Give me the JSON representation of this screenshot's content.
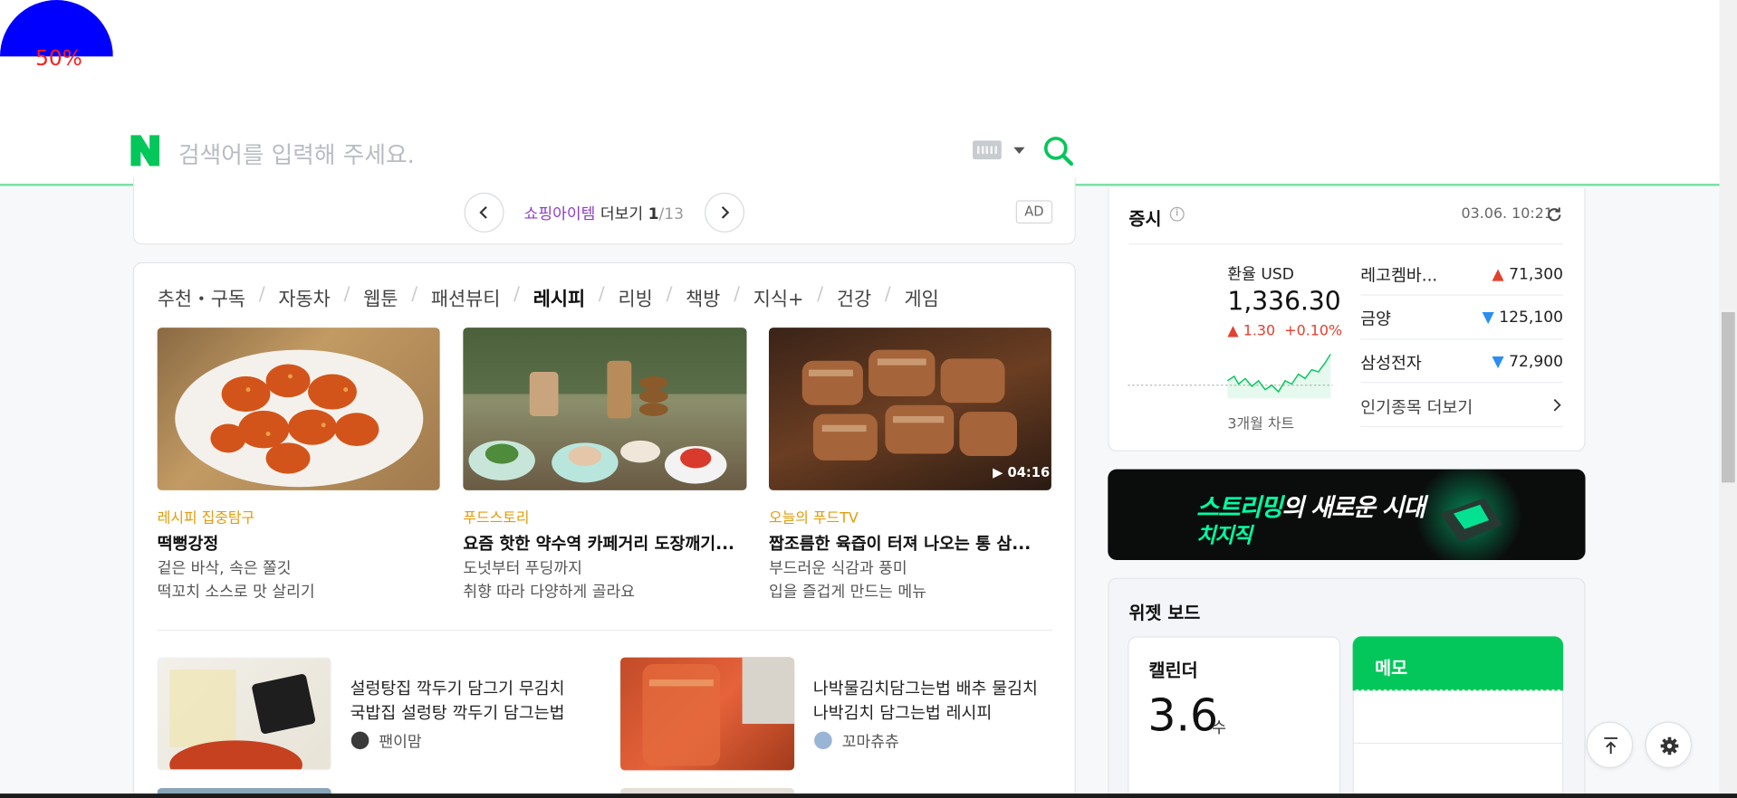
{
  "gauge": {
    "label": "50%",
    "fraction": 0.5,
    "color": "#0000ff",
    "label_color": "#ff1a1a"
  },
  "search": {
    "placeholder": "검색어를 입력해 주세요.",
    "brand_color": "#03c75a"
  },
  "icons": {
    "logo": "naver-n-logo-icon",
    "keyboard": "keyboard-icon",
    "dropdown": "caret-down-icon",
    "search": "search-icon",
    "prev": "chevron-left-icon",
    "next": "chevron-right-icon",
    "info": "info-icon",
    "refresh": "refresh-icon",
    "top": "scroll-top-icon",
    "settings": "gear-icon"
  },
  "shopping_pager": {
    "highlight": "쇼핑아이템",
    "more": " 더보기 ",
    "current": "1",
    "total": "/13",
    "ad": "AD"
  },
  "tabs": [
    {
      "label": "추천・구독"
    },
    {
      "label": "자동차"
    },
    {
      "label": "웹툰"
    },
    {
      "label": "패션뷰티"
    },
    {
      "label": "레시피",
      "active": true
    },
    {
      "label": "리빙"
    },
    {
      "label": "책방"
    },
    {
      "label": "지식+"
    },
    {
      "label": "건강"
    },
    {
      "label": "게임"
    }
  ],
  "cards": [
    {
      "category": "레시피 집중탐구",
      "title": "떡뻥강정",
      "desc1": "겉은 바삭, 속은 쫄깃",
      "desc2": "떡꼬치 소스로 맛 살리기"
    },
    {
      "category": "푸드스토리",
      "title": "요즘 핫한 약수역 카페거리 도장깨기...",
      "desc1": "도넛부터 푸딩까지",
      "desc2": "취향 따라 다양하게 골라요"
    },
    {
      "category": "오늘의 푸드TV",
      "title": "짭조름한 육즙이 터져 나오는 통 삼...",
      "desc1": "부드러운 식감과 풍미",
      "desc2": "입을 즐겁게 만드는 메뉴",
      "duration": "04:16"
    }
  ],
  "list": [
    {
      "line1": "설렁탕집 깍두기 담그기 무김치",
      "line2": "국밥집 설렁탕 깍두기 담그는법",
      "author": "팬이맘"
    },
    {
      "line1": "나박물김치담그는법 배추 물김치",
      "line2": "나박김치 담그는법 레시피",
      "author": "꼬마츄츄"
    }
  ],
  "stocks": {
    "title": "증시",
    "time": "03.06. 10:21",
    "fx": {
      "label": "환율 USD",
      "value": "1,336.30",
      "change": "1.30",
      "change_pct": "+0.10%",
      "chart_label": "3개월 차트"
    },
    "items": [
      {
        "name": "레고켐바...",
        "value": "71,300",
        "direction": "up"
      },
      {
        "name": "금양",
        "value": "125,100",
        "direction": "down"
      },
      {
        "name": "삼성전자",
        "value": "72,900",
        "direction": "down"
      }
    ],
    "more": "인기종목 더보기",
    "up_color": "#e2412d",
    "down_color": "#2b8ef0"
  },
  "banner": {
    "line1_highlight": "스트리밍",
    "line1_rest": "의 새로운 시대",
    "line2": "치지직",
    "accent": "#00ffa3"
  },
  "widget": {
    "title": "위젯 보드",
    "calendar": {
      "title": "캘린더",
      "date": "3.6",
      "weekday": "수"
    },
    "memo": {
      "title": "메모"
    }
  }
}
